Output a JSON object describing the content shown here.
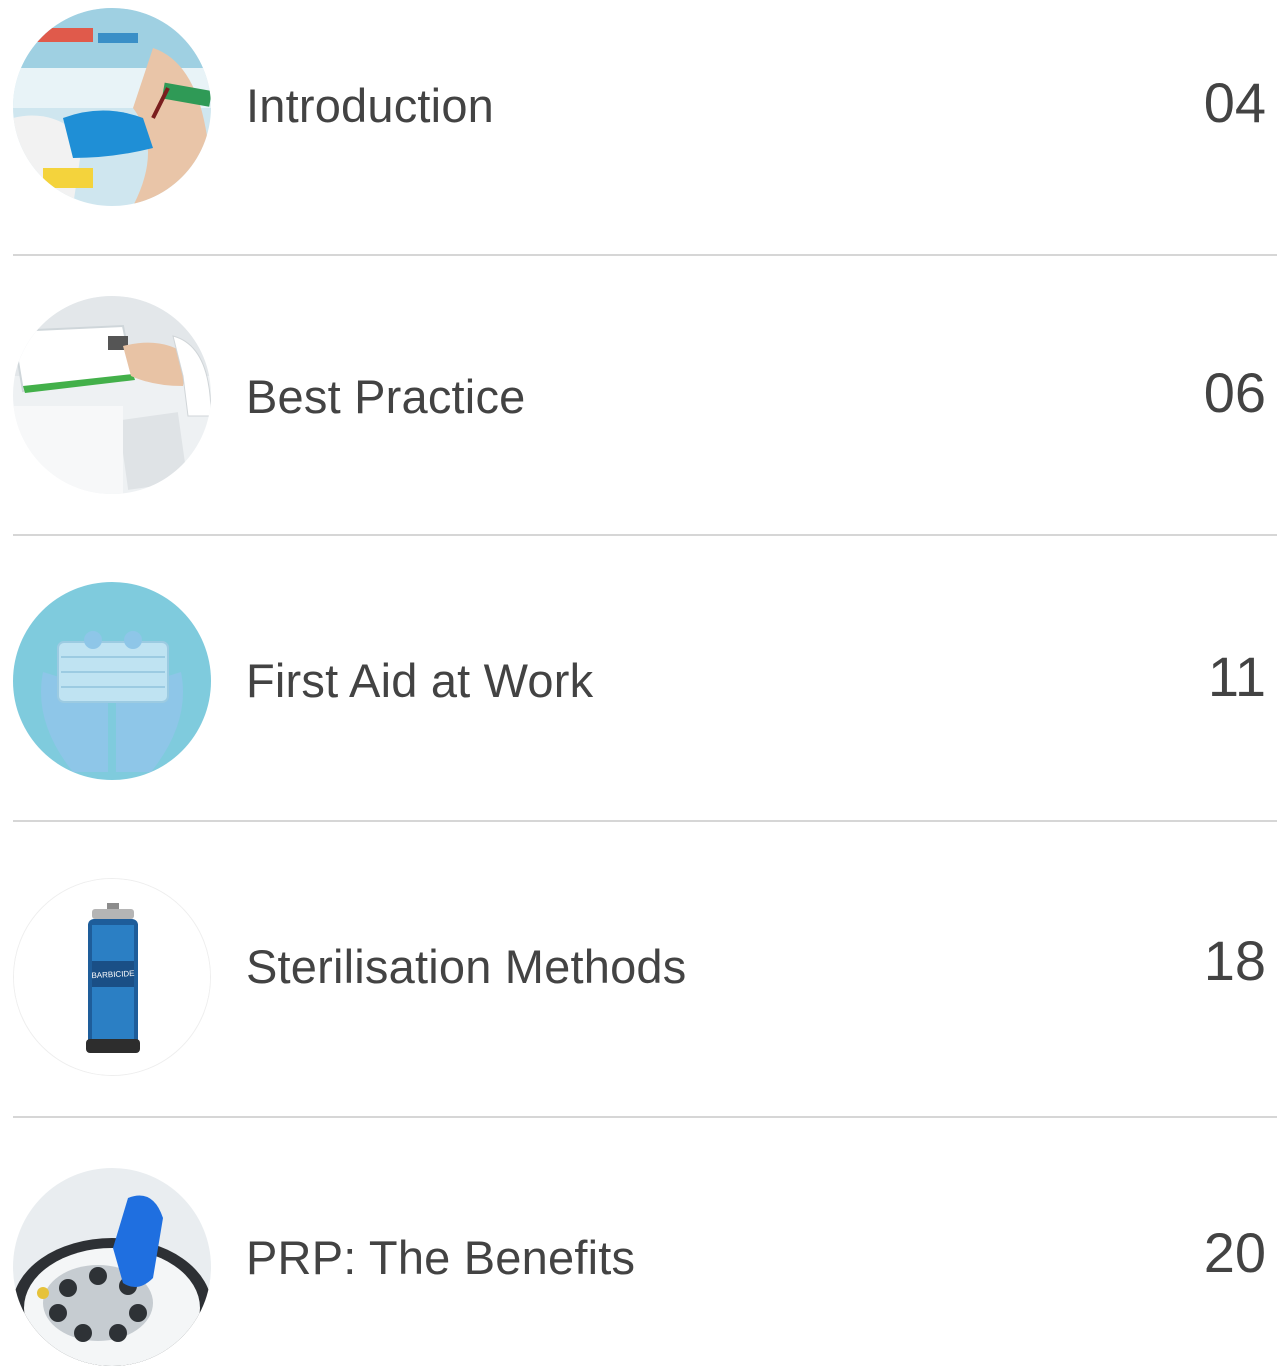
{
  "toc": {
    "entries": [
      {
        "title": "Introduction",
        "page": "04",
        "image": "blood-draw-photo"
      },
      {
        "title": "Best Practice",
        "page": "06",
        "image": "clipboard-handover-photo"
      },
      {
        "title": "First Aid at Work",
        "page": "11",
        "image": "gloved-hands-mask-photo"
      },
      {
        "title": "Sterilisation Methods",
        "page": "18",
        "image": "barbicide-jar-photo"
      },
      {
        "title": "PRP: The Benefits",
        "page": "20",
        "image": "centrifuge-photo"
      }
    ],
    "jar_label": "BARBICIDE"
  }
}
